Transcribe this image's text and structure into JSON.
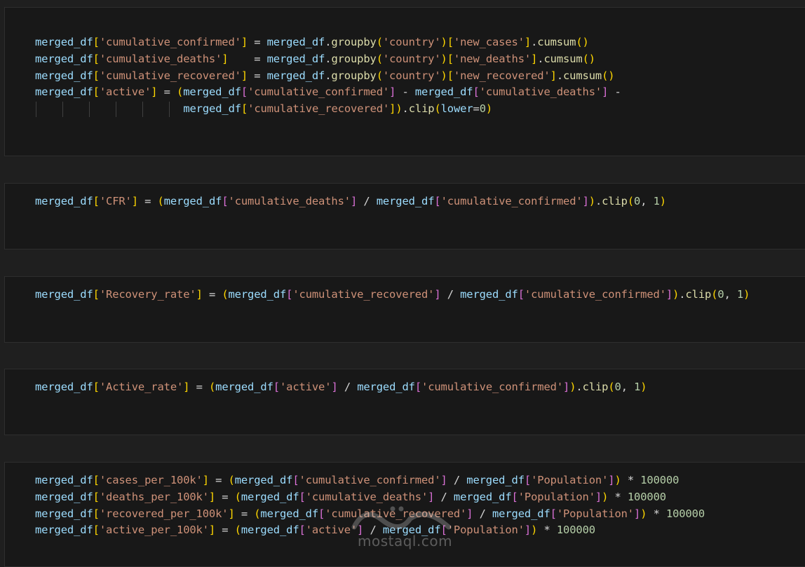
{
  "watermark": {
    "site": "mostaql.com"
  },
  "colors": {
    "background": "#1f1f1f",
    "cell_background": "#181818",
    "variable": "#9cdcfe",
    "function": "#dcdcaa",
    "string": "#ce9178",
    "number": "#b5cea8",
    "bracket_level_1": "#ffd700",
    "bracket_level_2": "#da70d6",
    "bracket_level_3": "#179fff"
  },
  "cells": [
    {
      "lines": [
        "merged_df['cumulative_confirmed'] = merged_df.groupby('country')['new_cases'].cumsum()",
        "merged_df['cumulative_deaths']    = merged_df.groupby('country')['new_deaths'].cumsum()",
        "merged_df['cumulative_recovered'] = merged_df.groupby('country')['new_recovered'].cumsum()",
        "merged_df['active'] = (merged_df['cumulative_confirmed'] - merged_df['cumulative_deaths'] -",
        "                       merged_df['cumulative_recovered']).clip(lower=0)"
      ]
    },
    {
      "lines": [
        "merged_df['CFR'] = (merged_df['cumulative_deaths'] / merged_df['cumulative_confirmed']).clip(0, 1)"
      ]
    },
    {
      "lines": [
        "merged_df['Recovery_rate'] = (merged_df['cumulative_recovered'] / merged_df['cumulative_confirmed']).clip(0, 1)"
      ]
    },
    {
      "lines": [
        "merged_df['Active_rate'] = (merged_df['active'] / merged_df['cumulative_confirmed']).clip(0, 1)"
      ]
    },
    {
      "lines": [
        "merged_df['cases_per_100k'] = (merged_df['cumulative_confirmed'] / merged_df['Population']) * 100000",
        "merged_df['deaths_per_100k'] = (merged_df['cumulative_deaths'] / merged_df['Population']) * 100000",
        "merged_df['recovered_per_100k'] = (merged_df['cumulative_recovered'] / merged_df['Population']) * 100000",
        "merged_df['active_per_100k'] = (merged_df['active'] / merged_df['Population']) * 100000"
      ]
    }
  ]
}
